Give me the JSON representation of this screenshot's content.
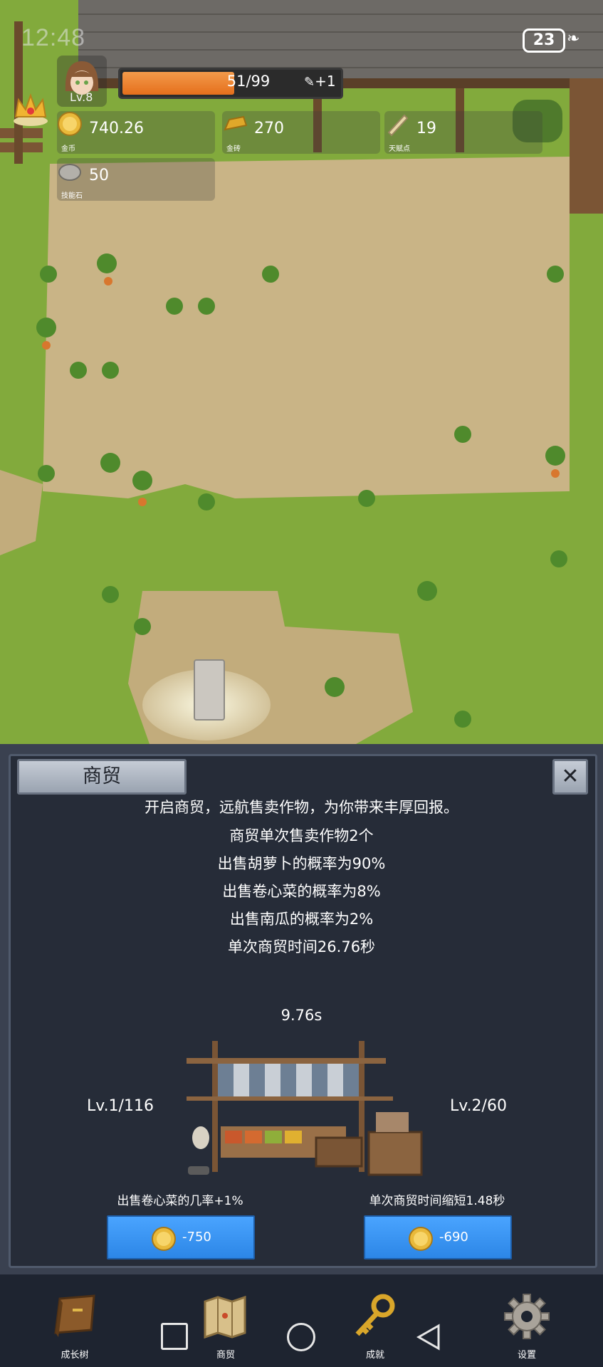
{
  "status_bar": {
    "time": "12:48",
    "battery": "23"
  },
  "player": {
    "level": "Lv.8",
    "xp_text": "51/99",
    "xp_fraction": 0.515,
    "xp_bonus": "+1"
  },
  "resources": [
    {
      "icon": "gold-coin-icon",
      "value": "740.26",
      "label": "金币"
    },
    {
      "icon": "gold-ingot-icon",
      "value": "270",
      "label": "金砖"
    },
    {
      "icon": "talent-scroll-icon",
      "value": "19",
      "label": "天赋点"
    },
    {
      "icon": "skill-stone-icon",
      "value": "50",
      "label": "技能石"
    }
  ],
  "trade_panel": {
    "title": "商贸",
    "close_icon": "close-icon",
    "description_lines": [
      "开启商贸，远航售卖作物，为你带来丰厚回报。",
      "商贸单次售卖作物2个",
      "出售胡萝卜的概率为90%",
      "出售卷心菜的概率为8%",
      "出售南瓜的概率为2%",
      "单次商贸时间26.76秒"
    ],
    "timer": "9.76s",
    "left_upgrade": {
      "level": "Lv.1/116",
      "effect": "出售卷心菜的几率+1%",
      "price": "-750"
    },
    "right_upgrade": {
      "level": "Lv.2/60",
      "effect": "单次商贸时间缩短1.48秒",
      "price": "-690"
    }
  },
  "nav": [
    {
      "label": "成长树",
      "icon": "book-icon"
    },
    {
      "label": "商贸",
      "icon": "map-icon"
    },
    {
      "label": "成就",
      "icon": "key-icon"
    },
    {
      "label": "设置",
      "icon": "gear-icon"
    }
  ],
  "colors": {
    "panel_bg": "#262c38",
    "button_blue": "#3a96f5",
    "xp_orange": "#e8782a"
  }
}
